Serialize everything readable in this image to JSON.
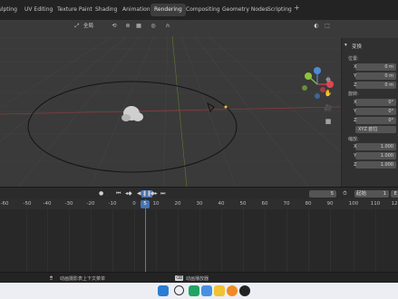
{
  "workspace_tabs": [
    "ulpting",
    "UV Editing",
    "Texture Paint",
    "Shading",
    "Animation",
    "Rendering",
    "Compositing",
    "Geometry Nodes",
    "Scripting"
  ],
  "active_tab": "Rendering",
  "add_tab": "+",
  "viewport_header": {
    "orientation": "全局"
  },
  "npanel": {
    "section": "变换",
    "location_label": "位置:",
    "location": [
      {
        "axis": "X",
        "value": "0 m"
      },
      {
        "axis": "Y",
        "value": "0 m"
      },
      {
        "axis": "Z",
        "value": "0 m"
      }
    ],
    "rotation_label": "旋转:",
    "rotation": [
      {
        "axis": "X",
        "value": "0°"
      },
      {
        "axis": "Y",
        "value": "0°"
      },
      {
        "axis": "Z",
        "value": "0°"
      }
    ],
    "rotation_mode": "XYZ 欧拉",
    "scale_label": "缩放:",
    "scale": [
      {
        "axis": "X",
        "value": "1.000"
      },
      {
        "axis": "Y",
        "value": "1.000"
      },
      {
        "axis": "Z",
        "value": "1.000"
      }
    ]
  },
  "timeline": {
    "current_frame": "5",
    "start_label": "起始",
    "start_value": "1",
    "end_value": "E",
    "ticks": [
      "-60",
      "-50",
      "-40",
      "-30",
      "-20",
      "-10",
      "0",
      "5",
      "10",
      "20",
      "30",
      "40",
      "50",
      "60",
      "70",
      "80",
      "90",
      "100",
      "110",
      "12"
    ]
  },
  "statusbar": {
    "left_text": "动画摄影表上下文菜单",
    "center_key": "⌫",
    "center_text": "动画播放器"
  },
  "colors": {
    "accent": "#4772b3",
    "gizmo_x": "#e0454f",
    "gizmo_y": "#8cc43b",
    "gizmo_z": "#4b8bd7"
  }
}
